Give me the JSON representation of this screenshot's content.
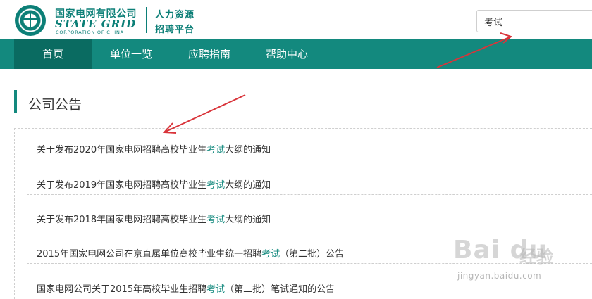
{
  "header": {
    "brand_cn": "国家电网有限公司",
    "brand_en": "STATE GRID",
    "brand_corp": "CORPORATION OF CHINA",
    "sub_line1": "人力资源",
    "sub_line2": "招聘平台",
    "search_value": "考试"
  },
  "nav": {
    "items": [
      {
        "label": "首页",
        "active": true
      },
      {
        "label": "单位一览",
        "active": false
      },
      {
        "label": "应聘指南",
        "active": false
      },
      {
        "label": "帮助中心",
        "active": false
      }
    ]
  },
  "section": {
    "title": "公司公告"
  },
  "announcements": [
    {
      "before": "关于发布2020年国家电网招聘高校毕业生",
      "keyword": "考试",
      "after": "大纲的通知"
    },
    {
      "before": "关于发布2019年国家电网招聘高校毕业生",
      "keyword": "考试",
      "after": "大纲的通知"
    },
    {
      "before": "关于发布2018年国家电网招聘高校毕业生",
      "keyword": "考试",
      "after": "大纲的通知"
    },
    {
      "before": "2015年国家电网公司在京直属单位高校毕业生统一招聘",
      "keyword": "考试",
      "after": "（第二批）公告"
    },
    {
      "before": "国家电网公司关于2015年高校毕业生招聘",
      "keyword": "考试",
      "after": "（第二批）笔试通知的公告"
    }
  ],
  "colors": {
    "brand": "#0c7f77",
    "nav_bg": "#13897e",
    "nav_active": "#0a6b61",
    "keyword": "#13897e",
    "annotation": "#d9343a"
  },
  "watermark": {
    "logo": "Bai du",
    "cn": "经验",
    "url": "jingyan.baidu.com"
  }
}
